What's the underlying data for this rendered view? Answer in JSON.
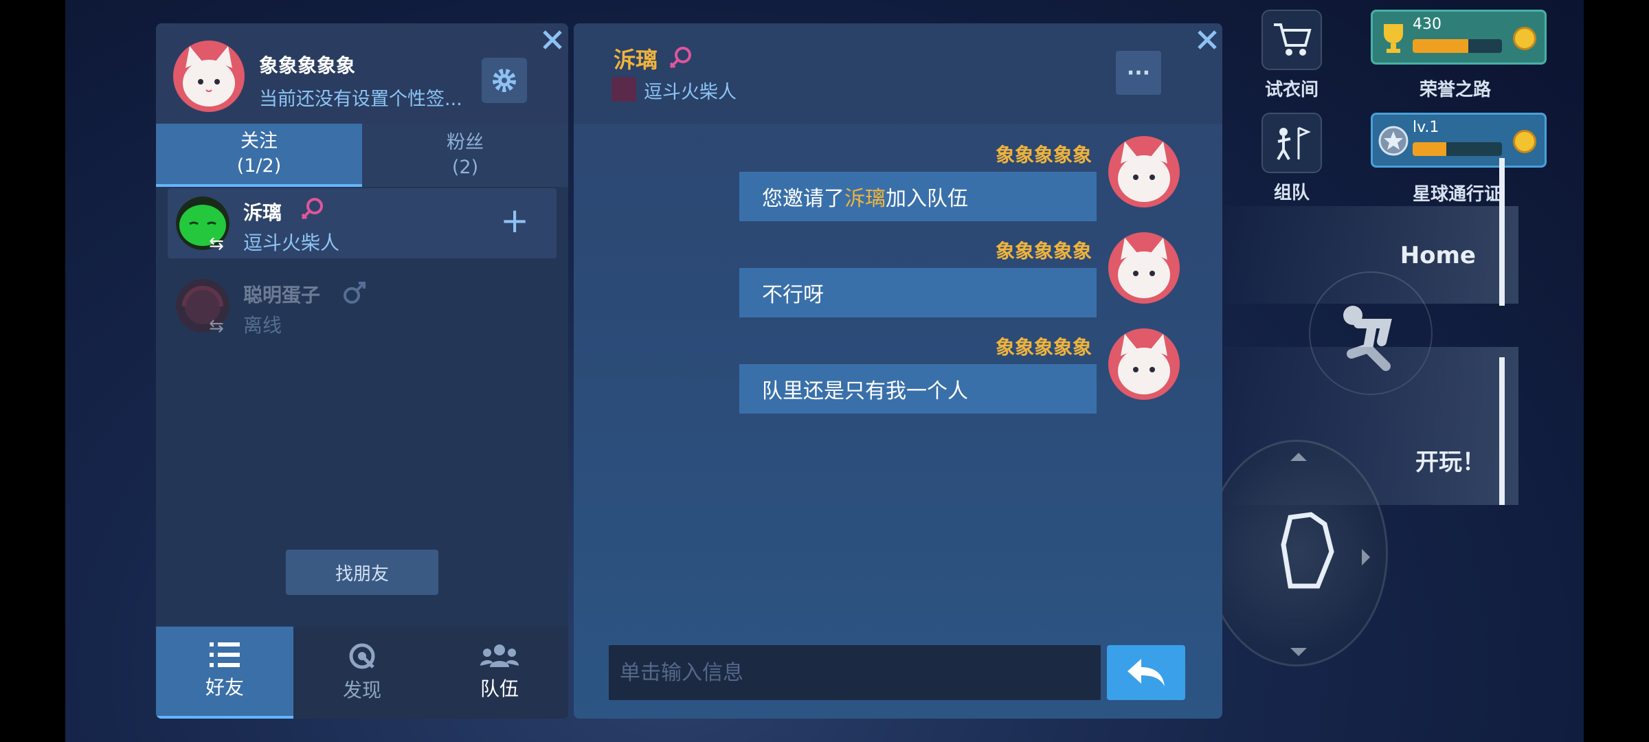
{
  "colors": {
    "accent_blue": "#3a6fa8",
    "highlight_gold": "#f0b43c",
    "link_blue": "#8cc4f4",
    "female_pink": "#e0559b",
    "male_blue": "#5d7fb5"
  },
  "game_hud": {
    "trial_room_label": "试衣间",
    "team_label": "组队",
    "honor": {
      "value": "430",
      "label": "荣誉之路",
      "progress": 0.62
    },
    "pass": {
      "value": "lv.1",
      "label": "星球通行证",
      "progress": 0.38
    },
    "home_label": "Home",
    "play_label": "开玩！"
  },
  "friends_panel": {
    "me": {
      "name": "象象象象象",
      "signature": "当前还没有设置个性签..."
    },
    "tabs": [
      {
        "label": "关注",
        "count": "(1/2)"
      },
      {
        "label": "粉丝",
        "count": "(2)"
      }
    ],
    "friends": [
      {
        "name": "泝璃",
        "gender_icon": "female-icon",
        "status": "逗斗火柴人"
      },
      {
        "name": "聪明蛋子",
        "gender_icon": "male-icon",
        "status": "离线"
      }
    ],
    "find_friends_label": "找朋友",
    "bottom_nav": [
      {
        "label": "好友",
        "icon": "list-icon"
      },
      {
        "label": "发现",
        "icon": "discover-icon"
      },
      {
        "label": "队伍",
        "icon": "team-icon"
      }
    ]
  },
  "chat": {
    "contact_name": "泝璃",
    "contact_gender_icon": "female-icon",
    "contact_status": "逗斗火柴人",
    "more_label": "···",
    "messages": [
      {
        "sender": "象象象象象",
        "text_before": "您邀请了",
        "highlight": "泝璃",
        "text_after": "加入队伍"
      },
      {
        "sender": "象象象象象",
        "text_before": "不行呀",
        "highlight": "",
        "text_after": ""
      },
      {
        "sender": "象象象象象",
        "text_before": "队里还是只有我一个人",
        "highlight": "",
        "text_after": ""
      }
    ],
    "input_placeholder": "单击输入信息"
  }
}
